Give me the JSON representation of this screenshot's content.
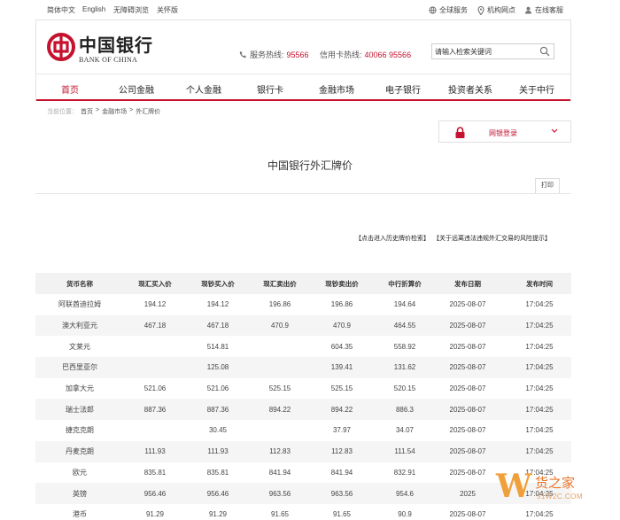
{
  "topbar": {
    "lang_simplified": "简体中文",
    "lang_english": "English",
    "accessibility": "无障碍浏览",
    "care_mode": "关怀版",
    "global_service": "全球服务",
    "branches": "机构网点",
    "online_support": "在线客服"
  },
  "header": {
    "logo_cn": "中国银行",
    "logo_en": "BANK OF CHINA",
    "service_hotline_label": "服务热线:",
    "service_hotline_number": "95566",
    "card_hotline_label": "信用卡热线:",
    "card_hotline_number": "40066 95566",
    "search_placeholder": "请输入检索关键词"
  },
  "nav": [
    "首页",
    "公司金融",
    "个人金融",
    "银行卡",
    "金融市场",
    "电子银行",
    "投资者关系",
    "关于中行"
  ],
  "breadcrumb": {
    "prefix": "当前位置：",
    "items": [
      "首页",
      ">",
      "金融市场",
      ">",
      "外汇牌价"
    ]
  },
  "login": {
    "label": "网银登录"
  },
  "page_title": "中国银行外汇牌价",
  "print_label": "打印",
  "links": {
    "history": "【点击进入历史牌价检索】",
    "risk": "【关于远离违法违规外汇交易的风险提示】"
  },
  "table": {
    "headers": [
      "货币名称",
      "现汇买入价",
      "现钞买入价",
      "现汇卖出价",
      "现钞卖出价",
      "中行折算价",
      "发布日期",
      "发布时间"
    ],
    "rows": [
      [
        "阿联酋迪拉姆",
        "194.12",
        "194.12",
        "196.86",
        "196.86",
        "194.64",
        "2025-08-07",
        "17:04:25"
      ],
      [
        "澳大利亚元",
        "467.18",
        "467.18",
        "470.9",
        "470.9",
        "464.55",
        "2025-08-07",
        "17:04:25"
      ],
      [
        "文莱元",
        "",
        "514.81",
        "",
        "604.35",
        "558.92",
        "2025-08-07",
        "17:04:25"
      ],
      [
        "巴西里亚尔",
        "",
        "125.08",
        "",
        "139.41",
        "131.62",
        "2025-08-07",
        "17:04:25"
      ],
      [
        "加拿大元",
        "521.06",
        "521.06",
        "525.15",
        "525.15",
        "520.15",
        "2025-08-07",
        "17:04:25"
      ],
      [
        "瑞士法郎",
        "887.36",
        "887.36",
        "894.22",
        "894.22",
        "886.3",
        "2025-08-07",
        "17:04:25"
      ],
      [
        "捷克克朗",
        "",
        "30.45",
        "",
        "37.97",
        "34.07",
        "2025-08-07",
        "17:04:25"
      ],
      [
        "丹麦克朗",
        "111.93",
        "111.93",
        "112.83",
        "112.83",
        "111.54",
        "2025-08-07",
        "17:04:25"
      ],
      [
        "欧元",
        "835.81",
        "835.81",
        "841.94",
        "841.94",
        "832.91",
        "2025-08-07",
        "17:04:25"
      ],
      [
        "英镑",
        "956.46",
        "956.46",
        "963.56",
        "963.56",
        "954.6",
        "2025",
        "17:04:25"
      ],
      [
        "港币",
        "91.29",
        "91.29",
        "91.65",
        "91.65",
        "90.9",
        "2025-08-07",
        "17:04:25"
      ]
    ]
  },
  "watermark": {
    "letter": "W",
    "cn": "货之家",
    "url": "51W2C.COM"
  },
  "colors": {
    "brand_red": "#c4122f",
    "watermark_orange": "#e8762b"
  }
}
